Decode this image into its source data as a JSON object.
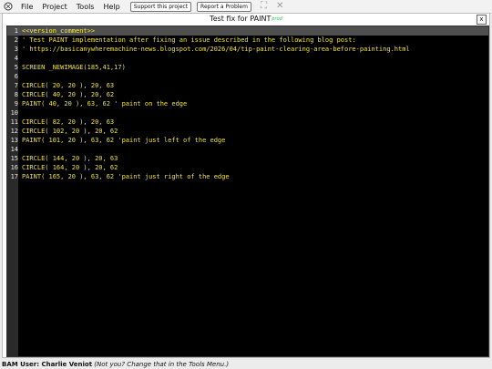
{
  "menu": {
    "items": [
      "File",
      "Project",
      "Tools",
      "Help"
    ],
    "support_label": "Support this project",
    "report_label": "Report a Problem",
    "icons": [
      "app-logo-icon",
      "fullscreen-icon",
      "close-icon"
    ]
  },
  "window": {
    "title": "Test fix for PAINT",
    "title_badge": "prod",
    "close_label": "x"
  },
  "editor": {
    "current_line": 1,
    "lines": [
      {
        "num": "1",
        "code": "<<version_comment>>"
      },
      {
        "num": "2",
        "code": "' Test PAINT implementation after fixing an issue described in the following blog post:"
      },
      {
        "num": "3",
        "code": "' https://basicanywheremachine-news.blogspot.com/2026/04/tip-paint-clearing-area-before-painting.html"
      },
      {
        "num": "4",
        "code": ""
      },
      {
        "num": "5",
        "code": "SCREEN _NEWIMAGE(185,41,17)"
      },
      {
        "num": "6",
        "code": ""
      },
      {
        "num": "7",
        "code": "CIRCLE( 20, 20 ), 20, 63"
      },
      {
        "num": "8",
        "code": "CIRCLE( 40, 20 ), 20, 62"
      },
      {
        "num": "9",
        "code": "PAINT( 40, 20 ), 63, 62 ' paint on the edge"
      },
      {
        "num": "10",
        "code": ""
      },
      {
        "num": "11",
        "code": "CIRCLE( 82, 20 ), 20, 63"
      },
      {
        "num": "12",
        "code": "CIRCLE( 102, 20 ), 20, 62"
      },
      {
        "num": "13",
        "code": "PAINT( 101, 20 ), 63, 62 'paint just left of the edge"
      },
      {
        "num": "14",
        "code": ""
      },
      {
        "num": "15",
        "code": "CIRCLE( 144, 20 ), 20, 63"
      },
      {
        "num": "16",
        "code": "CIRCLE( 164, 20 ), 20, 62"
      },
      {
        "num": "17",
        "code": "PAINT( 165, 20 ), 63, 62 'paint just right of the edge"
      }
    ]
  },
  "status": {
    "prefix": "BAM User: Charlie Veniot",
    "note": "(Not you? Change that in the Tools Menu.)"
  },
  "colors": {
    "code_text": "#f1e23a",
    "editor_bg": "#000000",
    "current_line_bg": "#4f4f4f",
    "badge": "#27c84a"
  }
}
